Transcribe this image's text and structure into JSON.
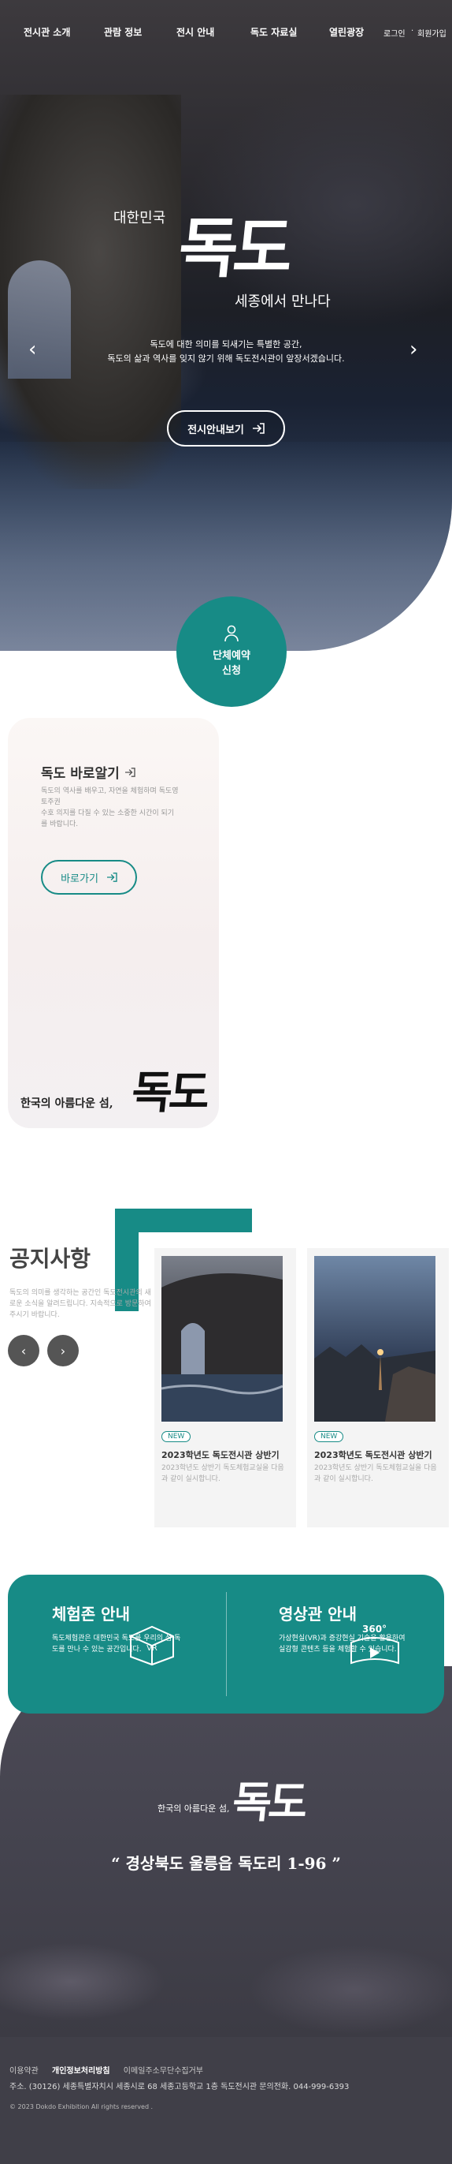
{
  "nav": {
    "items": [
      "전시관 소개",
      "관람 정보",
      "전시 안내",
      "독도 자료실",
      "열린광장"
    ],
    "login": "로그인",
    "sitemap": "회원가입"
  },
  "hero": {
    "sub1": "대한민국",
    "brush": "독도",
    "sub2": "세종에서 만나다",
    "desc_line1": "독도에 대한 의미를 되새기는 특별한 공간,",
    "desc_line2": "독도의 삶과 역사를 잊지 않기 위해 독도전시관이 앞장서겠습니다.",
    "button": "전시안내보기"
  },
  "reservation": {
    "label": "단체예약 신청"
  },
  "about": {
    "title": "독도 바로알기",
    "desc_line1": "독도의 역사를 배우고, 자연을 체험하며 독도영토주권",
    "desc_line2": "수호 의지를 다질 수 있는 소중한 시간이 되기를 바랍니다.",
    "button": "바로가기",
    "slogan": "한국의 아름다운 섬,",
    "brush": "독도"
  },
  "notice": {
    "title": "공지사항",
    "desc": "독도의 의미를 생각하는 공간인 독도전시관의 새로운 소식을 알려드립니다. 지속적으로 방문하여 주시기 바랍니다.",
    "cards": [
      {
        "badge": "NEW",
        "title": "2023학년도 독도전시관 상반기",
        "desc": "2023학년도 상반기 독도체험교실을 다음과 같이 실시합니다."
      },
      {
        "badge": "NEW",
        "title": "2023학년도 독도전시관 상반기",
        "desc": "2023학년도 상반기 독도체험교실을 다음과 같이 실시합니다."
      }
    ]
  },
  "experience": {
    "left_title": "체험존 안내",
    "left_desc": "독도체험관은 대한민국 독도를 우리의 섬 독도를 만나 수 있는 공간입니다.",
    "right_title": "영상관 안내",
    "right_desc": "가상현실(VR)과 증강현실 기술을 활용하여 실감형 콘텐츠 등을 체험할 수 있습니다.",
    "vr_label": "360°"
  },
  "closing": {
    "slogan": "한국의 아름다운 섬,",
    "brush": "독도",
    "address": "“ 경상북도 울릉읍 독도리 1-96 ”"
  },
  "footer": {
    "links": [
      "이용약관",
      "개인정보처리방침",
      "이메일주소무단수집거부"
    ],
    "address": "주소. (30126) 세종특별자치시 세종시로 68 세종고등학교 1층 독도전시관 문의전화. 044-999-6393",
    "copyright": "© 2023 Dokdo Exhibition All rights reserved ."
  },
  "colors": {
    "accent": "#178b86",
    "dark": "#403f48"
  }
}
